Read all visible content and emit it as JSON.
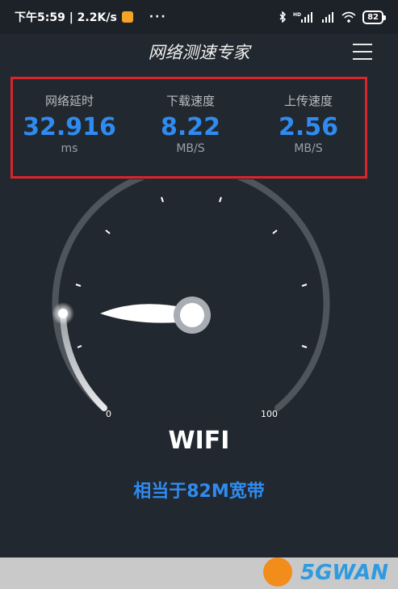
{
  "status_bar": {
    "time_speed": "下午5:59 | 2.2K/s",
    "more": "···",
    "network_badge": "HD",
    "battery": "82"
  },
  "header": {
    "title": "网络测速专家"
  },
  "stats": {
    "latency": {
      "label": "网络延时",
      "value": "32.916",
      "unit": "ms"
    },
    "download": {
      "label": "下载速度",
      "value": "8.22",
      "unit": "MB/S"
    },
    "upload": {
      "label": "上传速度",
      "value": "2.56",
      "unit": "MB/S"
    }
  },
  "gauge": {
    "min_label": "0",
    "max_label": "100",
    "value_fraction": 0.0
  },
  "connection_type": "WIFI",
  "bandwidth_text": "相当于82M宽带",
  "watermark": {
    "text": "5GWAN",
    "colors": {
      "logo": "#f28c1b",
      "text": "#2e9be0"
    }
  },
  "colors": {
    "accent": "#2f8bf0",
    "background": "#22282f",
    "highlight_border": "#d8262a"
  }
}
